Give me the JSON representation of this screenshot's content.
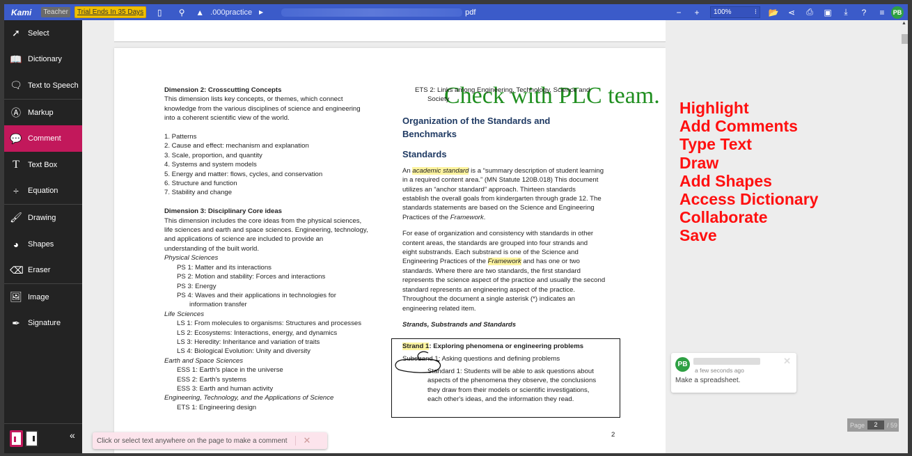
{
  "topbar": {
    "logo": "Kami",
    "role_badge": "Teacher",
    "trial_badge": "Trial Ends In 35 Days",
    "folder": ".000practice",
    "file_ext": "pdf",
    "zoom_value": "100%",
    "avatar_initials": "PB"
  },
  "sidebar": {
    "items": [
      {
        "label": "Select",
        "icon": "cursor-icon"
      },
      {
        "label": "Dictionary",
        "icon": "book-icon"
      },
      {
        "label": "Text to Speech",
        "icon": "speech-icon"
      },
      {
        "label": "Markup",
        "icon": "markup-icon"
      },
      {
        "label": "Comment",
        "icon": "comment-icon"
      },
      {
        "label": "Text Box",
        "icon": "text-icon"
      },
      {
        "label": "Equation",
        "icon": "divide-icon"
      },
      {
        "label": "Drawing",
        "icon": "brush-icon"
      },
      {
        "label": "Shapes",
        "icon": "shapes-icon"
      },
      {
        "label": "Eraser",
        "icon": "eraser-icon"
      },
      {
        "label": "Image",
        "icon": "image-icon"
      },
      {
        "label": "Signature",
        "icon": "pen-nib-icon"
      }
    ],
    "active": "Comment"
  },
  "comment_tools": {
    "colors": [
      "#ffff00",
      "#33ff11",
      "#ff1493"
    ]
  },
  "hint": {
    "text": "Click or select text anywhere on the page to make a comment"
  },
  "document": {
    "annotation_text": "Check with PLC team.",
    "left": {
      "dim2_title": "Dimension 2: Crosscutting Concepts",
      "dim2_body": [
        "This dimension lists key concepts, or themes, which connect",
        "knowledge from the various disciplines of science and engineering",
        "into a coherent scientific view of the world."
      ],
      "dim2_list": [
        "1. Patterns",
        "2. Cause and effect: mechanism and explanation",
        "3. Scale, proportion, and quantity",
        "4. Systems and system models",
        "5. Energy and matter: flows, cycles, and conservation",
        "6. Structure and function",
        "7. Stability and change"
      ],
      "dim3_title": "Dimension 3: Disciplinary Core ideas",
      "dim3_body": [
        "This dimension includes the core ideas from the physical sciences,",
        "life sciences and earth and space sciences. Engineering, technology,",
        "and applications of science are included to provide an",
        "understanding of the built world."
      ],
      "ps_title": "Physical Sciences",
      "ps": [
        "PS 1: Matter and its interactions",
        "PS 2: Motion and stability: Forces and interactions",
        "PS 3: Energy",
        "PS 4: Waves and their applications in technologies for"
      ],
      "ps4_cont": "information transfer",
      "ls_title": "Life Sciences",
      "ls": [
        "LS 1: From molecules to organisms: Structures and processes",
        "LS 2: Ecosystems: Interactions, energy, and dynamics",
        "LS 3: Heredity: Inheritance and variation of traits",
        "LS 4: Biological Evolution: Unity and diversity"
      ],
      "ess_title": "Earth and Space Sciences",
      "ess": [
        "ESS 1: Earth's place in the universe",
        "ESS 2: Earth's systems",
        "ESS 3: Earth and human activity"
      ],
      "ets_title": "Engineering, Technology, and the Applications of Science",
      "ets1": "ETS 1: Engineering design"
    },
    "right": {
      "ets2": "ETS 2: Links among Engineering, Technology, Science and",
      "ets2_cont": "Society",
      "org_heading_1": "Organization of the Standards and",
      "org_heading_2": "Benchmarks",
      "standards_heading": "Standards",
      "p1_pre": "An ",
      "p1_hl": "academic standard",
      "p1_post": " is a “summary description of student learning",
      "p1_lines": [
        "in a required content area.” (MN Statute 120B.018) This document",
        "utilizes an “anchor standard” approach. Thirteen standards",
        "establish the overall goals from kindergarten through grade 12. The",
        "standards statements are based on the Science and Engineering"
      ],
      "p1_last_pre": "Practices of the ",
      "p1_last_it": "Framework",
      "p1_last_post": ".",
      "p2_lines_a": [
        "For ease of organization and consistency with standards in other",
        "content areas, the standards are grouped into four strands and",
        "eight substrands. Each substrand is one of the Science and"
      ],
      "p2_l4_pre": "Engineering Practices of the ",
      "p2_l4_hl": "Framework",
      "p2_l4_post": " and has one or two",
      "p2_lines_b": [
        "standards. Where there are two standards, the first standard",
        "represents the science aspect of the practice and usually the second",
        "standard represents an engineering aspect of the practice.",
        "Throughout the document a single asterisk (*) indicates an",
        "engineering related item."
      ],
      "strands_heading": "Strands, Substrands and Standards",
      "strand1_hl": "Strand 1",
      "strand1_rest": ": Exploring phenomena or engineering problems",
      "substrand1": "Substrand 1:  Asking questions and defining problems",
      "standard1": [
        "Standard 1: Students will be able to ask questions about",
        "aspects of the phenomena they observe, the conclusions",
        "they draw from their models or scientific investigations,",
        "each other's ideas, and the information they read."
      ],
      "page_number": "2"
    }
  },
  "features_list": [
    "Highlight",
    "Add Comments",
    "Type Text",
    "Draw",
    "Add Shapes",
    "Access Dictionary",
    "Collaborate",
    "Save"
  ],
  "comment": {
    "initials": "PB",
    "time": "a few seconds ago",
    "text": "Make a spreadsheet."
  },
  "pager": {
    "label": "Page",
    "current": "2",
    "total": "/ 59"
  }
}
